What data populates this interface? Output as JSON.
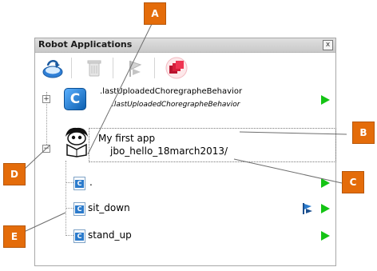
{
  "window": {
    "title": "Robot Applications",
    "close_glyph": "x"
  },
  "toolbar": {
    "buttons": [
      {
        "name": "install-icon",
        "enabled": true
      },
      {
        "name": "trash-icon",
        "enabled": false
      },
      {
        "name": "default-flag-icon",
        "enabled": false
      },
      {
        "name": "stop-all-icon",
        "enabled": true
      }
    ]
  },
  "tree": {
    "items": [
      {
        "name": ".lastUploadedChoregrapheBehavior",
        "path": ".lastUploadedChoregrapheBehavior",
        "icon": "choregraphe-c-icon"
      },
      {
        "name": "My first app",
        "path": "jbo_hello_18march2013/",
        "icon": "robot-avatar-icon",
        "behaviors": [
          {
            "name": ".",
            "icon": "behavior-c-icon",
            "default": false
          },
          {
            "name": "sit_down",
            "icon": "behavior-c-icon",
            "default": true
          },
          {
            "name": "stand_up",
            "icon": "behavior-c-icon",
            "default": false
          }
        ]
      }
    ]
  },
  "callouts": {
    "a": "A",
    "b": "B",
    "c": "C",
    "d": "D",
    "e": "E"
  },
  "colors": {
    "callout": "#e46c0a",
    "play": "#14c414",
    "accent_blue": "#2b7bcc",
    "stop_red": "#d61f3a"
  }
}
